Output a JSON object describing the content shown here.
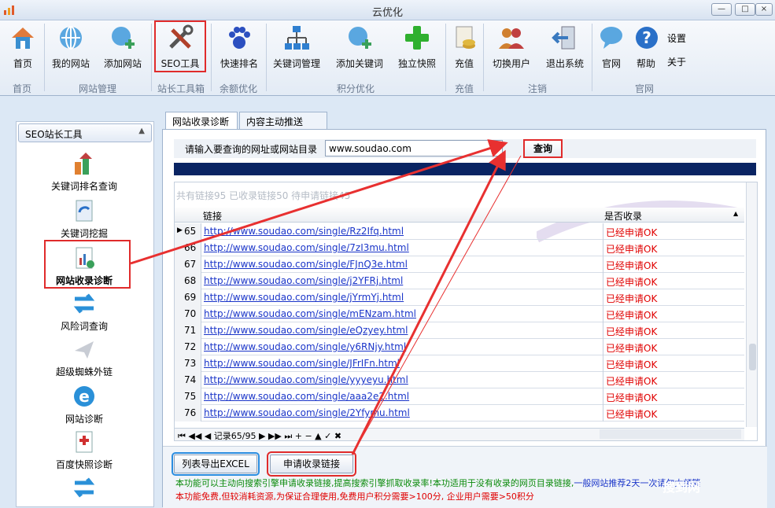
{
  "window": {
    "title": "云优化",
    "controls": [
      "—",
      "□",
      "×"
    ]
  },
  "ribbon": {
    "buttons": [
      {
        "label": "首页",
        "icon": "home-icon",
        "color": "#e07a3a"
      },
      {
        "label": "我的网站",
        "icon": "globe-icon",
        "color": "#3a8fd0"
      },
      {
        "label": "添加网站",
        "icon": "globe-add-icon",
        "color": "#3aa05a"
      },
      {
        "label": "SEO工具",
        "icon": "tools-icon",
        "color": "#b0402a"
      },
      {
        "label": "快速排名",
        "icon": "paw-icon",
        "color": "#2b4fc0"
      },
      {
        "label": "关键词管理",
        "icon": "sitemap-icon",
        "color": "#2f7fd0"
      },
      {
        "label": "添加关键词",
        "icon": "globe-add-icon",
        "color": "#3aa05a"
      },
      {
        "label": "独立快照",
        "icon": "plus-icon",
        "color": "#2fb02f"
      },
      {
        "label": "充值",
        "icon": "coins-icon",
        "color": "#d0a030"
      },
      {
        "label": "切换用户",
        "icon": "users-icon",
        "color": "#d08030"
      },
      {
        "label": "退出系统",
        "icon": "exit-icon",
        "color": "#3a7ac0"
      },
      {
        "label": "官网",
        "icon": "chat-icon",
        "color": "#3a8fd0"
      },
      {
        "label": "帮助",
        "icon": "help-icon",
        "color": "#2a70c8"
      }
    ],
    "side": [
      "设置",
      "关于"
    ],
    "groups": [
      "首页",
      "网站管理",
      "站长工具箱",
      "余额优化",
      "积分优化",
      "充值",
      "注销",
      "官网"
    ]
  },
  "sidebar": {
    "header": "SEO站长工具",
    "items": [
      "关键词排名查询",
      "关键词挖掘",
      "网站收录诊断",
      "风险词查询",
      "超级蜘蛛外链",
      "网站诊断",
      "百度快照诊断"
    ]
  },
  "tabs": [
    "网站收录诊断",
    "内容主动推送ping"
  ],
  "query": {
    "label": "请输入要查询的网址或网站目录",
    "value": "www.soudao.com",
    "button": "查询"
  },
  "grid": {
    "summary": "共有链接95 已收录链接50 待申请链接45",
    "columns": [
      "链接",
      "是否收录"
    ],
    "rows": [
      {
        "num": "65",
        "url": "http://www.soudao.com/single/Rz2Ifq.html",
        "status": "已经申请OK"
      },
      {
        "num": "66",
        "url": "http://www.soudao.com/single/7zI3mu.html",
        "status": "已经申请OK"
      },
      {
        "num": "67",
        "url": "http://www.soudao.com/single/FJnQ3e.html",
        "status": "已经申请OK"
      },
      {
        "num": "68",
        "url": "http://www.soudao.com/single/j2YFRj.html",
        "status": "已经申请OK"
      },
      {
        "num": "69",
        "url": "http://www.soudao.com/single/jYrmYj.html",
        "status": "已经申请OK"
      },
      {
        "num": "70",
        "url": "http://www.soudao.com/single/mENzam.html",
        "status": "已经申请OK"
      },
      {
        "num": "71",
        "url": "http://www.soudao.com/single/eQzyey.html",
        "status": "已经申请OK"
      },
      {
        "num": "72",
        "url": "http://www.soudao.com/single/y6RNjy.html",
        "status": "已经申请OK"
      },
      {
        "num": "73",
        "url": "http://www.soudao.com/single/JFrIFn.html",
        "status": "已经申请OK"
      },
      {
        "num": "74",
        "url": "http://www.soudao.com/single/yyyeyu.html",
        "status": "已经申请OK"
      },
      {
        "num": "75",
        "url": "http://www.soudao.com/single/aaa2e2.html",
        "status": "已经申请OK"
      },
      {
        "num": "76",
        "url": "http://www.soudao.com/single/2Yfymu.html",
        "status": "已经申请OK"
      }
    ],
    "pager": "记录65/95"
  },
  "buttons": {
    "export": "列表导出EXCEL",
    "apply": "申请收录链接"
  },
  "notes": {
    "line1": "本功能可以主动向搜索引擎申请收录链接,提高搜索引擎抓取收录率!本功适用于没有收录的网页目录链接,",
    "line1b": "一般网站推荐2天一次请勿太频繁",
    "line2": "本功能免费,但较消耗资源,为保证合理使用,免费用户积分需要>100分, 企业用户需要>50积分"
  },
  "watermark": "搜到网"
}
